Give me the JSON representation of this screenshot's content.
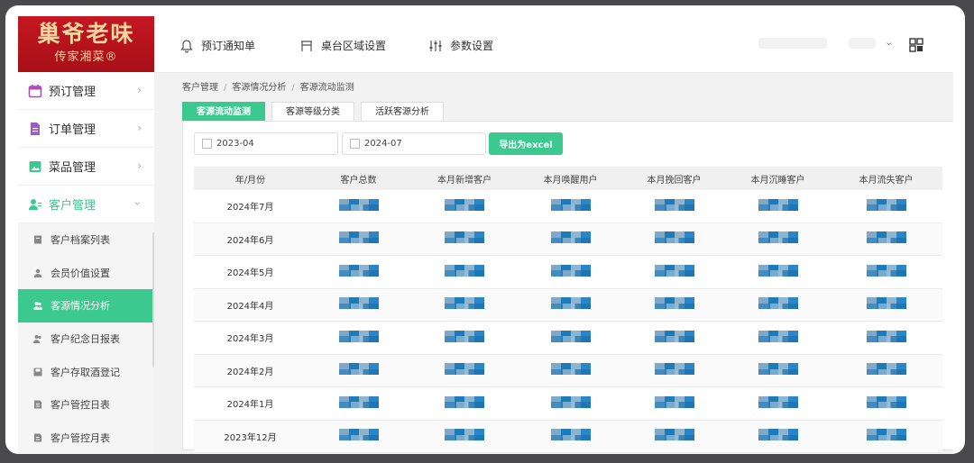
{
  "brand": {
    "name": "巢爷老味",
    "subtitle": "传家湘菜®"
  },
  "sidebar": {
    "menu": [
      {
        "label": "预订管理",
        "icon": "calendar-icon"
      },
      {
        "label": "订单管理",
        "icon": "document-icon"
      },
      {
        "label": "菜品管理",
        "icon": "image-icon"
      },
      {
        "label": "客户管理",
        "icon": "user-group-icon",
        "active": true
      }
    ],
    "submenu": [
      {
        "label": "客户档案列表"
      },
      {
        "label": "会员价值设置"
      },
      {
        "label": "客源情况分析",
        "active": true
      },
      {
        "label": "客户纪念日报表"
      },
      {
        "label": "客户存取酒登记"
      },
      {
        "label": "客户管控日表"
      },
      {
        "label": "客户管控月表"
      }
    ]
  },
  "topbar": {
    "nav": [
      {
        "label": "预订通知单",
        "icon": "bell-icon"
      },
      {
        "label": "桌台区域设置",
        "icon": "table-icon"
      },
      {
        "label": "参数设置",
        "icon": "sliders-icon"
      }
    ]
  },
  "breadcrumb": [
    "客户管理",
    "客源情况分析",
    "客源流动监测"
  ],
  "tabs": [
    {
      "label": "客源流动监测",
      "active": true
    },
    {
      "label": "客源等级分类"
    },
    {
      "label": "活跃客源分析"
    }
  ],
  "filters": {
    "start_month": "2023-04",
    "end_month": "2024-07",
    "export_label": "导出为excel"
  },
  "table": {
    "columns": [
      "年/月份",
      "客户总数",
      "本月新增客户",
      "本月唤醒用户",
      "本月挽回客户",
      "本月沉睡客户",
      "本月流失客户"
    ],
    "rows": [
      "2024年7月",
      "2024年6月",
      "2024年5月",
      "2024年4月",
      "2024年3月",
      "2024年2月",
      "2024年1月",
      "2023年12月"
    ]
  },
  "colors": {
    "accent": "#3cc98f",
    "brand_red": "#b8121c"
  }
}
